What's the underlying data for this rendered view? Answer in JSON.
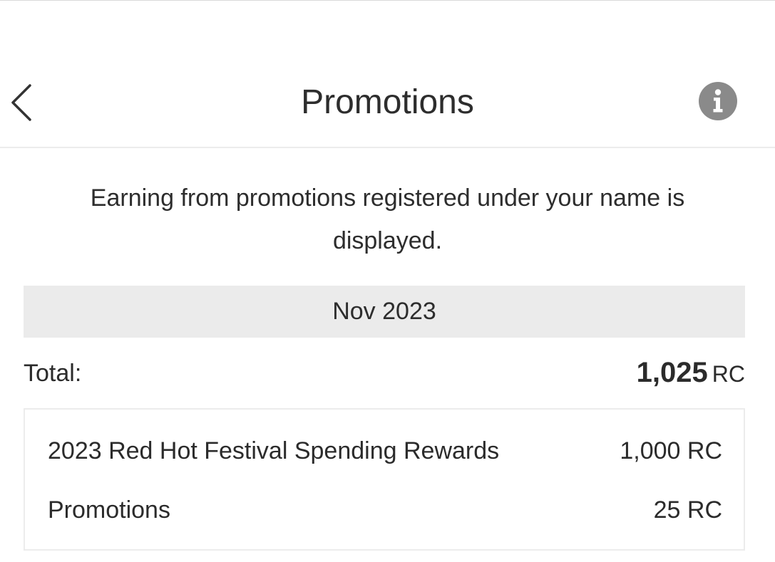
{
  "header": {
    "title": "Promotions",
    "back_icon": "chevron-left-icon",
    "info_icon": "info-icon",
    "info_icon_color": "#8a8a8a"
  },
  "description": "Earning from promotions registered under your name is displayed.",
  "period": {
    "month_label": "Nov 2023",
    "total_label": "Total:",
    "total_amount": "1,025",
    "total_unit": "RC"
  },
  "promotions": [
    {
      "name": "2023 Red Hot Festival Spending Rewards",
      "amount": "1,000 RC"
    },
    {
      "name": "Promotions",
      "amount": "25 RC"
    }
  ]
}
